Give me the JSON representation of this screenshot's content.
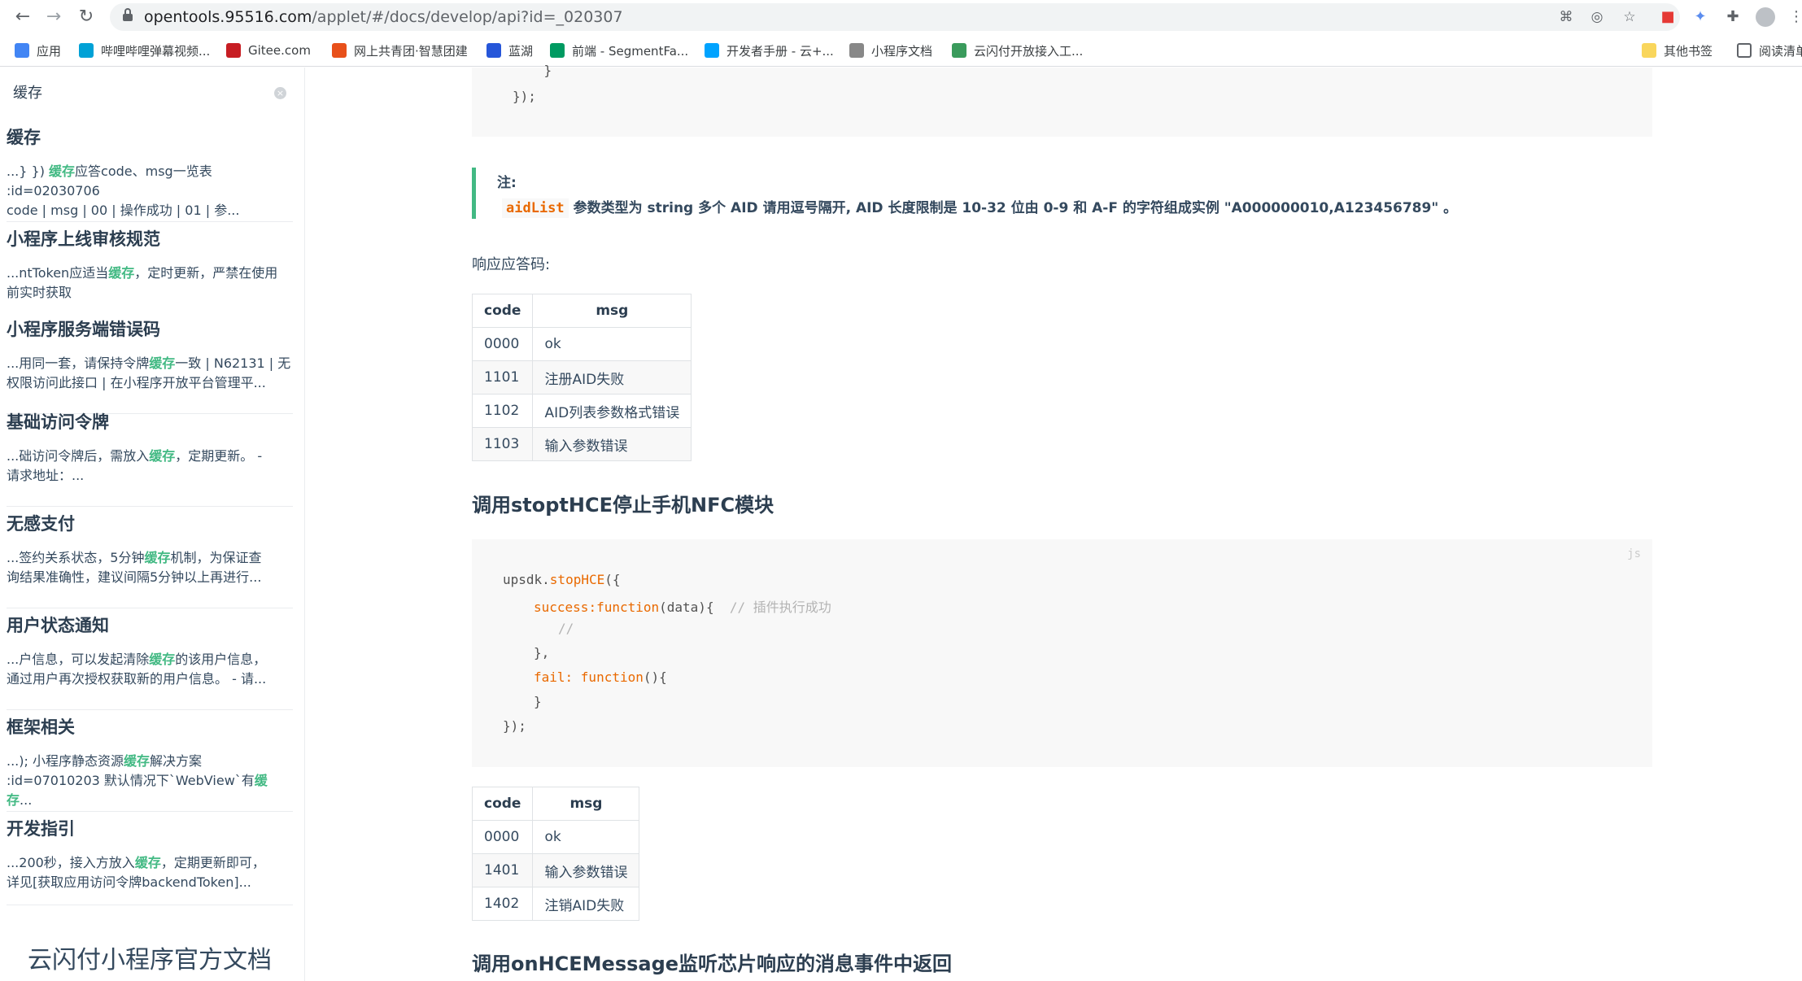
{
  "browser": {
    "url_host": "opentools.95516.com",
    "url_path": "/applet/#/docs/develop/api?id=_020307",
    "bookmarks": [
      {
        "label": "应用",
        "color": "#4285f4"
      },
      {
        "label": "哔哩哔哩弹幕视频...",
        "color": "#00a1d6"
      },
      {
        "label": "Gitee.com",
        "color": "#c71d23"
      },
      {
        "label": "网上共青团·智慧团建",
        "color": "#e8501a"
      },
      {
        "label": "蓝湖",
        "color": "#2656d9"
      },
      {
        "label": "前端 - SegmentFa...",
        "color": "#009a61"
      },
      {
        "label": "开发者手册 - 云+...",
        "color": "#00a3ff"
      },
      {
        "label": "小程序文档",
        "color": "#888888"
      },
      {
        "label": "云闪付开放接入工...",
        "color": "#3a9b5c"
      }
    ],
    "other_bookmarks": "其他书签",
    "reading_list": "阅读清单"
  },
  "sidebar": {
    "search_value": "缓存",
    "results": [
      {
        "title": "缓存",
        "pre": "...} }) ",
        "hl": "缓存",
        "post": "应答code、msg一览表 :id=02030706\ncode | msg | 00 | 操作成功 | 01 | 参..."
      },
      {
        "title": "小程序上线审核规范",
        "pre": "...ntToken应适当",
        "hl": "缓存",
        "post": "，定时更新，严禁在使用\n前实时获取"
      },
      {
        "title": "小程序服务端错误码",
        "pre": "...用同一套，请保持令牌",
        "hl": "缓存",
        "post": "一致 | N62131 | 无\n权限访问此接口 | 在小程序开放平台管理平..."
      },
      {
        "title": "基础访问令牌",
        "pre": "...础访问令牌后，需放入",
        "hl": "缓存",
        "post": "，定期更新。 -\n请求地址：..."
      },
      {
        "title": "无感支付",
        "pre": "...签约关系状态，5分钟",
        "hl": "缓存",
        "post": "机制，为保证查\n询结果准确性，建议间隔5分钟以上再进行..."
      },
      {
        "title": "用户状态通知",
        "pre": "...户信息，可以发起清除",
        "hl": "缓存",
        "post": "的该用户信息，\n通过用户再次授权获取新的用户信息。 - 请..."
      },
      {
        "title": "框架相关",
        "pre": "...); 小程序静态资源",
        "hl": "缓存",
        "post": "解决方案\n:id=07010203 默认情况下`WebView`有",
        "hl2": "缓存",
        "post2": "..."
      },
      {
        "title": "开发指引",
        "pre": "...200秒，接入方放入",
        "hl": "缓存",
        "post": "，定期更新即可，\n详见[获取应用访问令牌backendToken]..."
      }
    ],
    "brand": "云闪付小程序官方文档"
  },
  "main": {
    "top_code": [
      "    }",
      "});"
    ],
    "note": {
      "title": "注:",
      "code": "aidList",
      "text": " 参数类型为 string 多个 AID 请用逗号隔开, AID 长度限制是 10-32 位由 0-9 和 A-F 的字符组成实例 \"A000000010,A123456789\" 。"
    },
    "response_label": "响应应答码:",
    "table1": {
      "headers": [
        "code",
        "msg"
      ],
      "rows": [
        [
          "0000",
          "ok"
        ],
        [
          "1101",
          "注册AID失败"
        ],
        [
          "1102",
          "AID列表参数格式错误"
        ],
        [
          "1103",
          "输入参数错误"
        ]
      ]
    },
    "heading_stop": "调用stoptHCE停止手机NFC模块",
    "code_lang": "js",
    "stop_code": {
      "l1_a": "upsdk.",
      "l1_b": "stopHCE",
      "l1_c": "({",
      "l2_a": "success",
      "l2_b": ":function",
      "l2_c": "(data){  ",
      "l2_d": "// 插件执行成功",
      "l3": "//",
      "l4": "},",
      "l5_a": "fail",
      "l5_b": ": function",
      "l5_c": "(){",
      "l6": "}",
      "l7": "});"
    },
    "table2": {
      "headers": [
        "code",
        "msg"
      ],
      "rows": [
        [
          "0000",
          "ok"
        ],
        [
          "1401",
          "输入参数错误"
        ],
        [
          "1402",
          "注销AID失败"
        ]
      ]
    },
    "heading_message": "调用onHCEMessage监听芯片响应的消息事件中返回"
  }
}
